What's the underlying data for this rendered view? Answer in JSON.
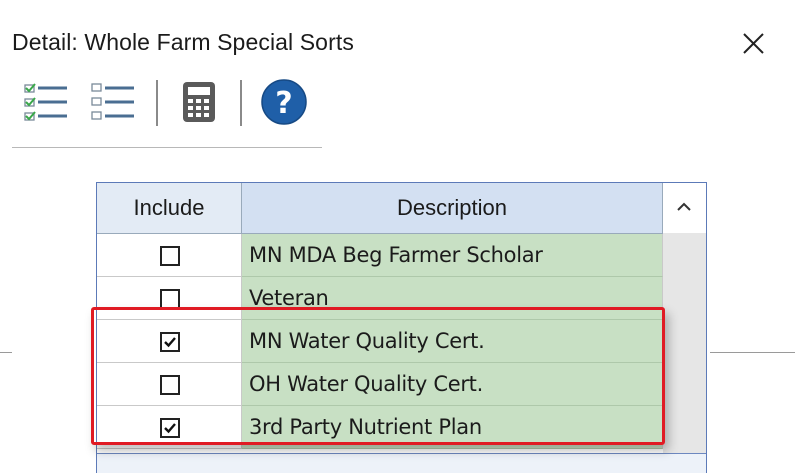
{
  "window": {
    "title": "Detail: Whole Farm Special Sorts",
    "close_label": "Close"
  },
  "toolbar": {
    "buttons": [
      {
        "name": "select-all-icon"
      },
      {
        "name": "deselect-all-icon"
      },
      {
        "name": "calculator-icon"
      },
      {
        "name": "help-icon"
      }
    ]
  },
  "grid": {
    "columns": [
      "Include",
      "Description"
    ],
    "rows": [
      {
        "include": false,
        "description": "MN MDA Beg Farmer Scholar"
      },
      {
        "include": false,
        "description": "Veteran"
      },
      {
        "include": true,
        "description": "MN Water Quality Cert."
      },
      {
        "include": false,
        "description": "OH Water Quality Cert."
      },
      {
        "include": true,
        "description": "3rd Party Nutrient Plan"
      }
    ]
  },
  "colors": {
    "accent_highlight": "#e01b24",
    "description_cell": "#c8e0c4",
    "header_bg": "#d3e0f2",
    "help_icon": "#1f5fa8"
  }
}
